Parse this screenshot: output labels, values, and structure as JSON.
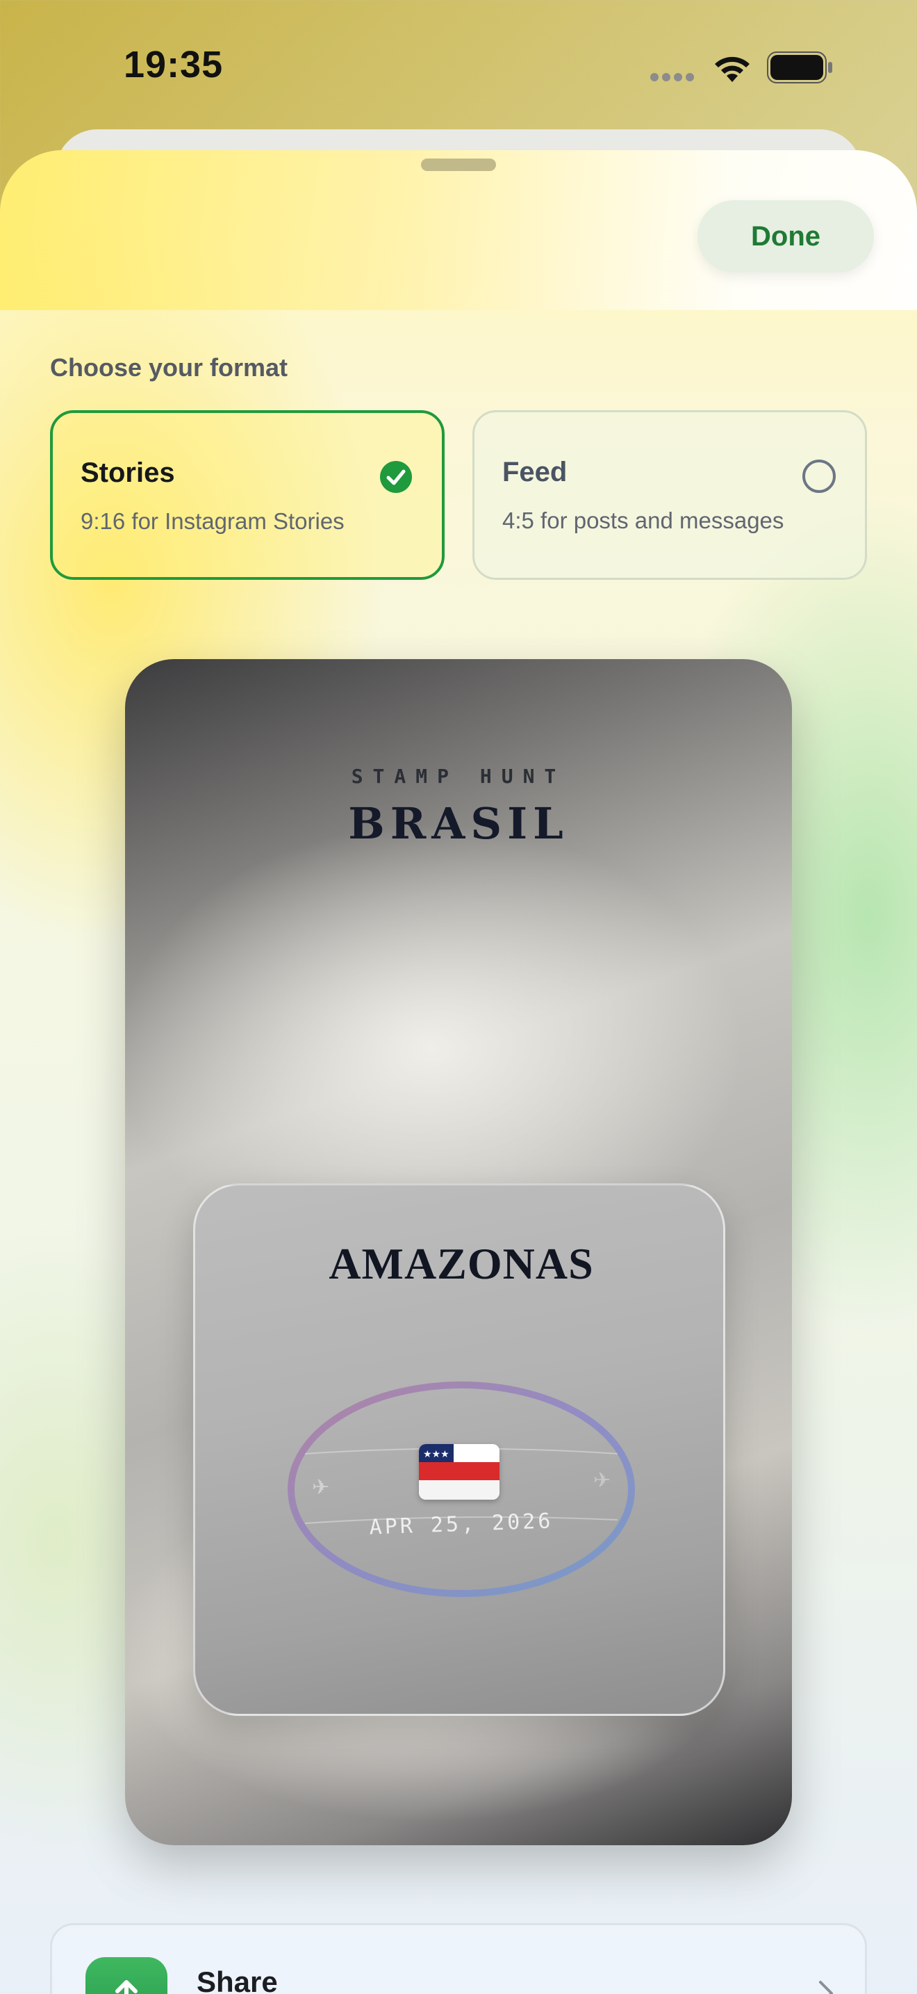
{
  "status_bar": {
    "time": "19:35"
  },
  "sheet": {
    "done_label": "Done",
    "section_label": "Choose your format",
    "formats": [
      {
        "title": "Stories",
        "subtitle": "9:16 for Instagram Stories",
        "selected": true
      },
      {
        "title": "Feed",
        "subtitle": "4:5 for posts and messages",
        "selected": false
      }
    ]
  },
  "preview": {
    "eyebrow": "STAMP HUNT",
    "title": "BRASIL",
    "stamp": {
      "name": "AMAZONAS",
      "date": "APR 25, 2026",
      "flag_icon": "amazonas-flag-icon"
    }
  },
  "actions": {
    "share_label": "Share",
    "share_icon": "share-icon"
  },
  "colors": {
    "accent_green": "#1f9a3c",
    "done_text": "#1f7a34"
  }
}
